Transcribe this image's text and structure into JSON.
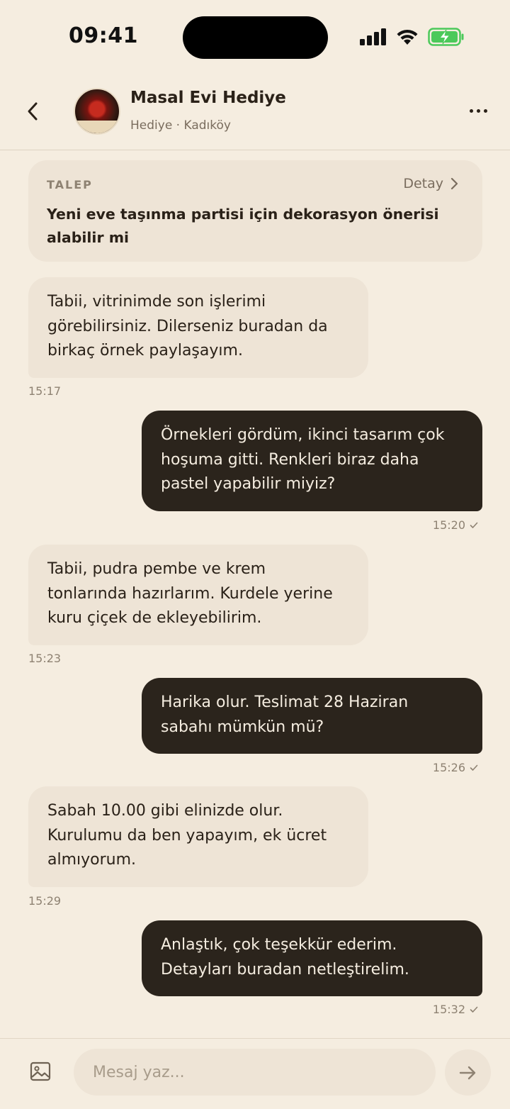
{
  "status_bar": {
    "time": "09:41"
  },
  "header": {
    "contact_name": "Masal Evi Hediye",
    "contact_subtitle": "Hediye · Kadıköy"
  },
  "request": {
    "label": "TALEP",
    "detail_label": "Detay",
    "text": "Yeni eve taşınma partisi için dekorasyon önerisi alabilir mi"
  },
  "messages": [
    {
      "direction": "in",
      "text": "Tabii, vitrinimde son işlerimi görebilirsiniz. Dilerseniz buradan da birkaç örnek paylaşayım.",
      "time": "15:17"
    },
    {
      "direction": "out",
      "text": "Örnekleri gördüm, ikinci tasarım çok hoşuma gitti. Renkleri biraz daha pastel yapabilir miyiz?",
      "time": "15:20"
    },
    {
      "direction": "in",
      "text": "Tabii, pudra pembe ve krem tonlarında hazırlarım. Kurdele yerine kuru çiçek de ekleyebilirim.",
      "time": "15:23"
    },
    {
      "direction": "out",
      "text": "Harika olur. Teslimat 28 Haziran sabahı mümkün mü?",
      "time": "15:26"
    },
    {
      "direction": "in",
      "text": "Sabah 10.00 gibi elinizde olur. Kurulumu da ben yapayım, ek ücret almıyorum.",
      "time": "15:29"
    },
    {
      "direction": "out",
      "text": "Anlaştık, çok teşekkür ederim. Detayları buradan netleştirelim.",
      "time": "15:32"
    }
  ],
  "composer": {
    "placeholder": "Mesaj yaz...",
    "value": ""
  },
  "colors": {
    "background": "#F5EDE0",
    "incoming_bubble": "#EEE4D6",
    "outgoing_bubble": "#2B241C",
    "battery": "#4CC95A"
  }
}
